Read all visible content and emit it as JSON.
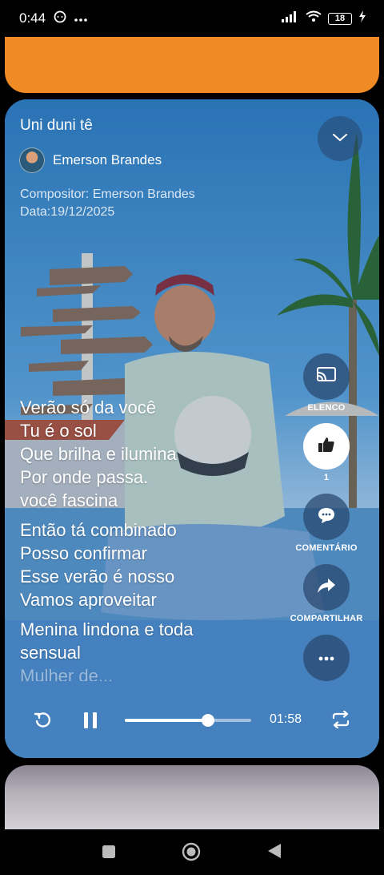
{
  "status_bar": {
    "time": "0:44",
    "notification_icons": [
      "chat-icon",
      "more-dots-icon"
    ],
    "battery": "18",
    "signal_icons": [
      "signal-icon",
      "wifi-icon",
      "battery-icon",
      "charging-icon"
    ]
  },
  "player": {
    "title": "Uni duni tê",
    "artist": "Emerson Brandes",
    "composer": "Compositor: Emerson Brandes",
    "date": "Data:19/12/2025",
    "lyrics": [
      [
        "Verão só da você",
        "Tu é o sol",
        "Que brilha e ilumina",
        "Por onde passa.",
        "você fascina"
      ],
      [
        "Então tá combinado",
        "Posso confirmar",
        "Esse verão é nosso",
        "Vamos aproveitar"
      ],
      [
        "Menina lindona e toda",
        "sensual",
        "Mulher de..."
      ]
    ],
    "actions": {
      "cast_label": "ELENCO",
      "like_count": "1",
      "comment_label": "COMENTÁRIO",
      "share_label": "COMPARTILHAR"
    },
    "time": "01:58",
    "progress": 0.66,
    "accent_color": "#f08a24"
  }
}
